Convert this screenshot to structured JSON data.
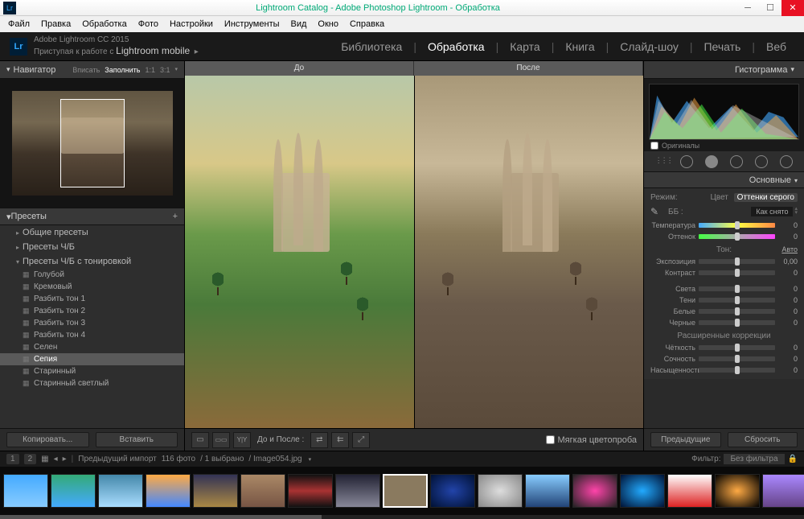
{
  "window": {
    "title": "Lightroom Catalog - Adobe Photoshop Lightroom - Обработка",
    "logo": "Lr"
  },
  "menu": [
    "Файл",
    "Правка",
    "Обработка",
    "Фото",
    "Настройки",
    "Инструменты",
    "Вид",
    "Окно",
    "Справка"
  ],
  "header": {
    "line1": "Adobe Lightroom CC 2015",
    "line2_pre": "Приступая к работе с ",
    "line2_main": "Lightroom mobile"
  },
  "modules": [
    "Библиотека",
    "Обработка",
    "Карта",
    "Книга",
    "Слайд-шоу",
    "Печать",
    "Веб"
  ],
  "active_module": "Обработка",
  "navigator": {
    "title": "Навигатор",
    "opts": [
      "Вписать",
      "Заполнить",
      "1:1",
      "3:1"
    ],
    "active_opt": "Заполнить"
  },
  "presets": {
    "title": "Пресеты",
    "groups": [
      "Общие пресеты",
      "Пресеты Ч/Б",
      "Пресеты Ч/Б с тонировкой"
    ],
    "items": [
      "Голубой",
      "Кремовый",
      "Разбить тон 1",
      "Разбить тон 2",
      "Разбить тон 3",
      "Разбить тон 4",
      "Селен",
      "Сепия",
      "Старинный",
      "Старинный светлый"
    ],
    "selected": "Сепия"
  },
  "left_buttons": {
    "copy": "Копировать...",
    "paste": "Вставить"
  },
  "compare": {
    "before": "До",
    "after": "После"
  },
  "center_toolbar": {
    "mode_label": "До и После :",
    "softproof": "Мягкая цветопроба"
  },
  "right": {
    "histogram": "Гистограмма",
    "originals": "Оригиналы",
    "basic": "Основные",
    "mode_label": "Режим:",
    "mode_color": "Цвет",
    "mode_gray": "Оттенки серого",
    "wb_label": "ББ :",
    "wb_value": "Как снято",
    "tone": "Тон:",
    "auto": "Авто",
    "presence": "Расширенные коррекции",
    "sliders": {
      "temp": {
        "label": "Температура",
        "val": "0"
      },
      "tint": {
        "label": "Оттенок",
        "val": "0"
      },
      "expo": {
        "label": "Экспозиция",
        "val": "0,00"
      },
      "contrast": {
        "label": "Контраст",
        "val": "0"
      },
      "highlights": {
        "label": "Света",
        "val": "0"
      },
      "shadows": {
        "label": "Тени",
        "val": "0"
      },
      "whites": {
        "label": "Белые",
        "val": "0"
      },
      "blacks": {
        "label": "Черные",
        "val": "0"
      },
      "clarity": {
        "label": "Чёткость",
        "val": "0"
      },
      "vibrance": {
        "label": "Сочность",
        "val": "0"
      },
      "saturation": {
        "label": "Насыщенность",
        "val": "0"
      }
    },
    "prev": "Предыдущие",
    "reset": "Сбросить"
  },
  "filmstrip": {
    "grid1": "1",
    "grid2": "2",
    "import_label": "Предыдущий импорт",
    "count": "116 фото",
    "selected": "/ 1 выбрано",
    "filename": "/ Image054.jpg",
    "filter_label": "Фильтр:",
    "filter_value": "Без фильтра"
  }
}
